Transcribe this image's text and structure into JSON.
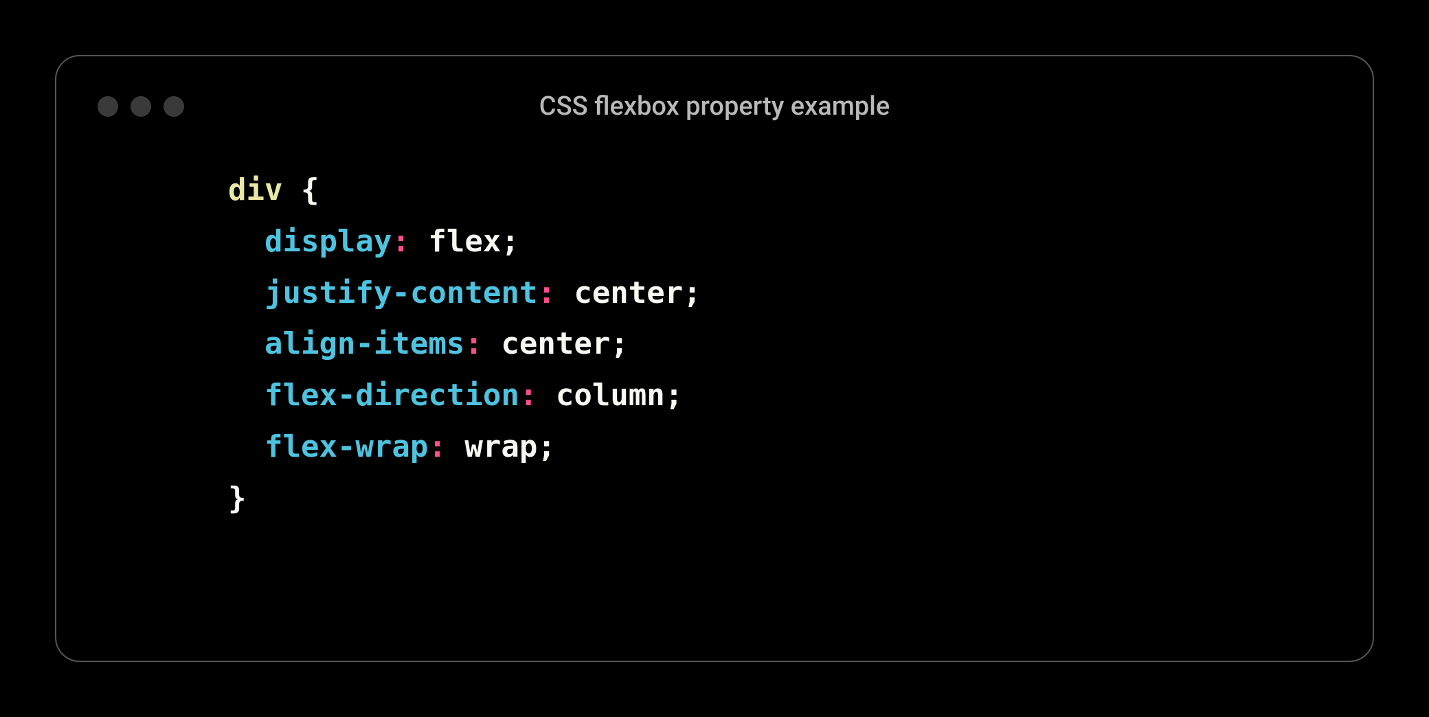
{
  "window": {
    "title": "CSS flexbox property example"
  },
  "code": {
    "selector": "div",
    "open_brace": "{",
    "close_brace": "}",
    "declarations": [
      {
        "property": "display",
        "value": "flex"
      },
      {
        "property": "justify-content",
        "value": "center"
      },
      {
        "property": "align-items",
        "value": "center"
      },
      {
        "property": "flex-direction",
        "value": "column"
      },
      {
        "property": "flex-wrap",
        "value": "wrap"
      }
    ]
  },
  "syntax": {
    "colon": ":",
    "semicolon": ";"
  },
  "colors": {
    "background": "#000000",
    "border": "#555555",
    "title_text": "#b9b9b9",
    "traffic_light": "#3a3a3a",
    "selector": "#e8e8a5",
    "property": "#4ec3e0",
    "colon": "#ff4d8d",
    "default_text": "#f8f8f2"
  }
}
